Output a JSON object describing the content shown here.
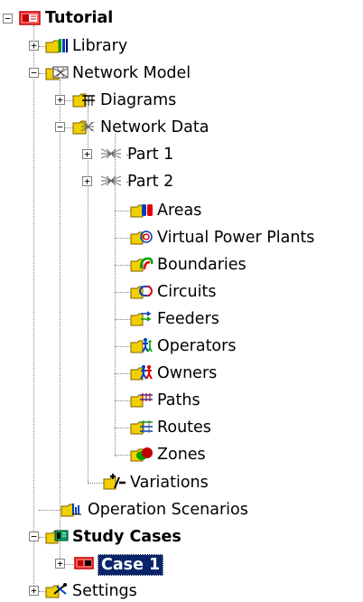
{
  "tree": {
    "root": {
      "label": "Tutorial"
    },
    "library": {
      "label": "Library"
    },
    "network_model": {
      "label": "Network Model"
    },
    "diagrams": {
      "label": "Diagrams"
    },
    "network_data": {
      "label": "Network Data"
    },
    "part1": {
      "label": "Part 1"
    },
    "part2": {
      "label": "Part 2"
    },
    "areas": {
      "label": "Areas"
    },
    "vpp": {
      "label": "Virtual Power Plants"
    },
    "boundaries": {
      "label": "Boundaries"
    },
    "circuits": {
      "label": "Circuits"
    },
    "feeders": {
      "label": "Feeders"
    },
    "operators": {
      "label": "Operators"
    },
    "owners": {
      "label": "Owners"
    },
    "paths": {
      "label": "Paths"
    },
    "routes": {
      "label": "Routes"
    },
    "zones": {
      "label": "Zones"
    },
    "variations": {
      "label": "Variations"
    },
    "operation_scenarios": {
      "label": "Operation Scenarios"
    },
    "study_cases": {
      "label": "Study Cases"
    },
    "case1": {
      "label": "Case 1"
    },
    "settings": {
      "label": "Settings"
    }
  },
  "expanders": {
    "minus": "−",
    "plus": "+"
  }
}
